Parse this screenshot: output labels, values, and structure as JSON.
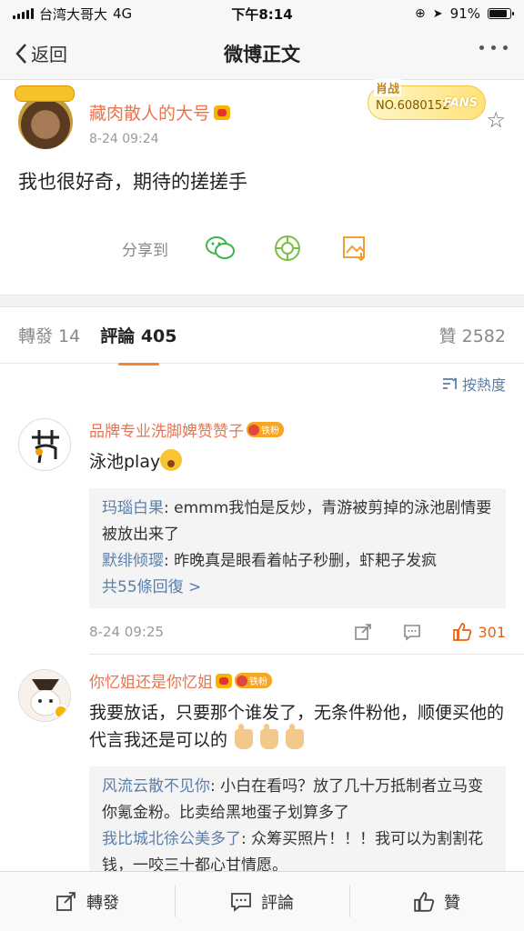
{
  "status_bar": {
    "carrier": "台湾大哥大",
    "network": "4G",
    "time": "下午8:14",
    "battery": "91%"
  },
  "nav": {
    "back_label": "返回",
    "title": "微博正文"
  },
  "post": {
    "author": "藏肉散人的大号",
    "time": "8-24 09:24",
    "fans_badge": {
      "idol": "肖战",
      "number": "NO.6080152",
      "label": "FANS"
    },
    "text": "我也很好奇，期待的搓搓手",
    "share_label": "分享到"
  },
  "tabs": {
    "repost": "轉發 14",
    "comments": "評論 405",
    "likes": "贊 2582"
  },
  "sort_label": "按熱度",
  "comments": [
    {
      "name": "品牌专业洗脚婢赞赞子",
      "badge": "铁粉",
      "text": "泳池play",
      "replies": [
        {
          "name": "玛瑙白果",
          "text": ": emmm我怕是反炒，青游被剪掉的泳池剧情要被放出来了"
        },
        {
          "name": "默绯倾璎",
          "text": ": 昨晚真是眼看着帖子秒删，虾耙子发疯"
        }
      ],
      "more_replies": "共55條回復 >",
      "time": "8-24 09:25",
      "likes": "301"
    },
    {
      "name": "你忆姐还是你忆姐",
      "badge": "铁粉",
      "text": "我要放话，只要那个谁发了，无条件粉他，顺便买他的代言我还是可以的",
      "replies": [
        {
          "name": "风流云散不见你",
          "text": ": 小白在看吗？放了几十万抵制者立马变你氪金粉。比卖给黑地蛋子划算多了"
        },
        {
          "name": "我比城北徐公美多了",
          "text": ": 众筹买照片！！！我可以为割割花钱，一咬三十都心甘情愿。"
        }
      ]
    }
  ],
  "bottom_bar": {
    "repost": "轉發",
    "comment": "評論",
    "like": "贊"
  },
  "colors": {
    "accent_orange": "#eb7350",
    "link_blue": "#5b7faa",
    "like_orange": "#e8600f"
  }
}
